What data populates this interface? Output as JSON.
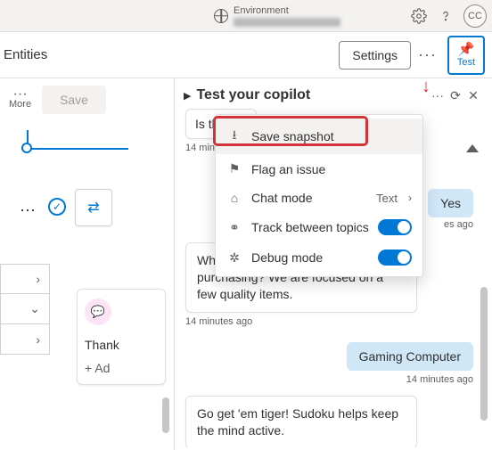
{
  "topbar": {
    "env_label": "Environment",
    "avatar_initials": "CC"
  },
  "subbar": {
    "title": "Entities",
    "settings_label": "Settings",
    "test_label": "Test"
  },
  "left": {
    "more_label": "More",
    "save_label": "Save",
    "card_title": "Thank",
    "card_add": "+  Ad"
  },
  "panel": {
    "title": "Test your copilot"
  },
  "menu": {
    "save_snapshot": "Save snapshot",
    "flag_issue": "Flag an issue",
    "chat_mode": "Chat mode",
    "chat_mode_value": "Text",
    "track_topics": "Track between topics",
    "debug_mode": "Debug mode"
  },
  "chat": {
    "user1": "Is that",
    "ts1": "14 minutes ago",
    "yes": "Yes",
    "ts_yes": "es ago",
    "bot1": "What can you tell me about your purchasing? We are focused on a few quality items.",
    "ts2": "14 minutes ago",
    "gaming": "Gaming Computer",
    "ts3": "14 minutes ago",
    "bot2": "Go get 'em tiger! Sudoku helps keep the mind active."
  }
}
